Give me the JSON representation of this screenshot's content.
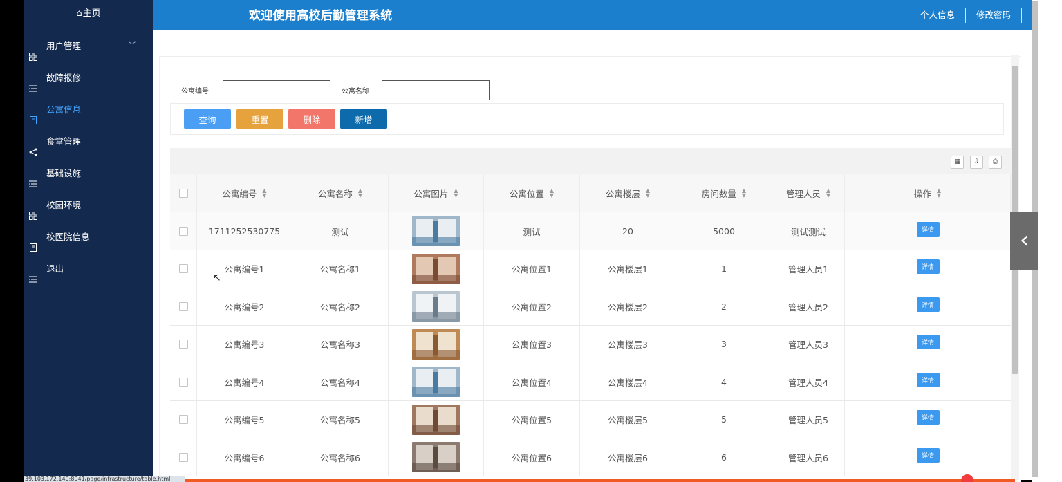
{
  "sidebar": {
    "home": "主页",
    "items": [
      {
        "label": "用户管理",
        "icon": "grid-icon",
        "has_chevron": true
      },
      {
        "label": "故障报修",
        "icon": "list-icon"
      },
      {
        "label": "公寓信息",
        "icon": "book-icon",
        "active": true
      },
      {
        "label": "食堂管理",
        "icon": "share-icon"
      },
      {
        "label": "基础设施",
        "icon": "list-icon"
      },
      {
        "label": "校园环境",
        "icon": "grid-icon"
      },
      {
        "label": "校医院信息",
        "icon": "book-icon"
      },
      {
        "label": "退出",
        "icon": "list-icon"
      }
    ]
  },
  "header": {
    "title": "欢迎使用高校后勤管理系统",
    "links": [
      "个人信息",
      "修改密码"
    ]
  },
  "search": {
    "field1_label": "公寓编号",
    "field1_value": "",
    "field2_label": "公寓名称",
    "field2_value": ""
  },
  "buttons": {
    "query": "查询",
    "reset": "重置",
    "delete": "删除",
    "add": "新增"
  },
  "table": {
    "columns": [
      "公寓编号",
      "公寓名称",
      "公寓图片",
      "公寓位置",
      "公寓楼层",
      "房间数量",
      "管理人员",
      "操作"
    ],
    "action_label": "详情",
    "rows": [
      {
        "code": "1711252530775",
        "name": "测试",
        "location": "测试",
        "floor": "20",
        "rooms": "5000",
        "manager": "测试测试"
      },
      {
        "code": "公寓编号1",
        "name": "公寓名称1",
        "location": "公寓位置1",
        "floor": "公寓楼层1",
        "rooms": "1",
        "manager": "管理人员1"
      },
      {
        "code": "公寓编号2",
        "name": "公寓名称2",
        "location": "公寓位置2",
        "floor": "公寓楼层2",
        "rooms": "2",
        "manager": "管理人员2"
      },
      {
        "code": "公寓编号3",
        "name": "公寓名称3",
        "location": "公寓位置3",
        "floor": "公寓楼层3",
        "rooms": "3",
        "manager": "管理人员3"
      },
      {
        "code": "公寓编号4",
        "name": "公寓名称4",
        "location": "公寓位置4",
        "floor": "公寓楼层4",
        "rooms": "4",
        "manager": "管理人员4"
      },
      {
        "code": "公寓编号5",
        "name": "公寓名称5",
        "location": "公寓位置5",
        "floor": "公寓楼层5",
        "rooms": "5",
        "manager": "管理人员5"
      },
      {
        "code": "公寓编号6",
        "name": "公寓名称6",
        "location": "公寓位置6",
        "floor": "公寓楼层6",
        "rooms": "6",
        "manager": "管理人员6"
      }
    ]
  },
  "status_url": "39.103.172.140:8041/page/infrastructure/table.html",
  "colors": {
    "sidebar_bg": "#13294d",
    "topbar_bg": "#1b7fcd",
    "active": "#43a4ff",
    "query_btn": "#4a9ff5",
    "reset_btn": "#e6a23c",
    "delete_btn": "#f3766a",
    "add_btn": "#0d6aab",
    "detail_btn": "#3b9af0"
  }
}
